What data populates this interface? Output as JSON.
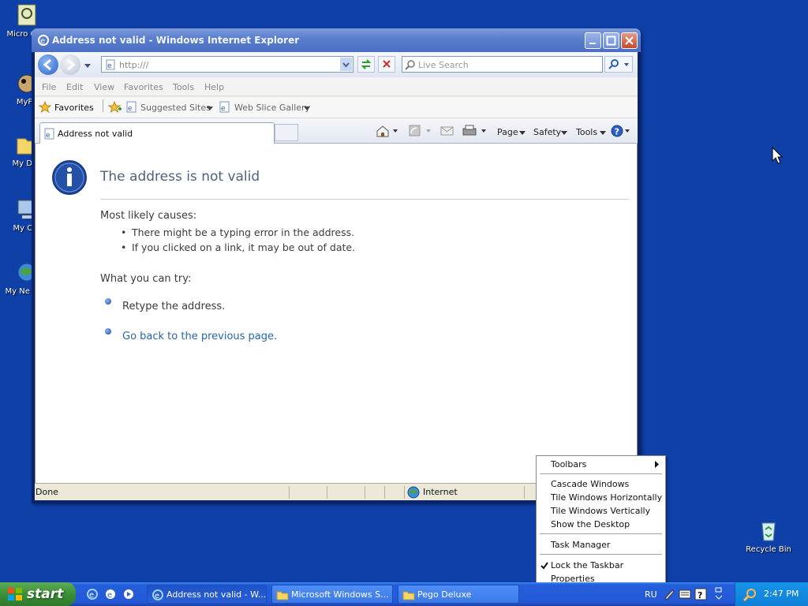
{
  "desktop": {
    "icons": [
      {
        "label": "Micro Outl",
        "icon": "outlook-icon"
      },
      {
        "label": "MyPa",
        "icon": "mypaint-icon"
      },
      {
        "label": "My Doc",
        "icon": "my-documents-icon"
      },
      {
        "label": "My Cor",
        "icon": "my-computer-icon"
      },
      {
        "label": "My Ne Plac",
        "icon": "network-places-icon"
      },
      {
        "label": "Recycle Bin",
        "icon": "recycle-bin-icon"
      }
    ]
  },
  "window": {
    "title": "Address not valid - Windows Internet Explorer",
    "address": "http:///",
    "search_placeholder": "Live Search",
    "menu": [
      "File",
      "Edit",
      "View",
      "Favorites",
      "Tools",
      "Help"
    ],
    "favorites": {
      "favorites_label": "Favorites",
      "suggested_sites": "Suggested Sites",
      "web_slice_gallery": "Web Slice Gallery"
    },
    "tab_label": "Address not valid",
    "commands": {
      "page": "Page",
      "safety": "Safety",
      "tools": "Tools"
    },
    "content": {
      "heading": "The address is not valid",
      "causes_title": "Most likely causes:",
      "causes": [
        "There might be a typing error in the address.",
        "If you clicked on a link, it may be out of date."
      ],
      "try_title": "What you can try:",
      "try_items": [
        "Retype the address.",
        "Go back to the previous page."
      ]
    },
    "status": {
      "left": "Done",
      "zone": "Internet"
    }
  },
  "context_menu": {
    "items": [
      "Toolbars",
      "Cascade Windows",
      "Tile Windows Horizontally",
      "Tile Windows Vertically",
      "Show the Desktop",
      "Task Manager",
      "Lock the Taskbar",
      "Properties"
    ]
  },
  "taskbar": {
    "start_label": "start",
    "tasks": [
      "Address not valid - W...",
      "Microsoft Windows S...",
      "Pego Deluxe"
    ],
    "language": "RU",
    "clock": "2:47 PM"
  }
}
